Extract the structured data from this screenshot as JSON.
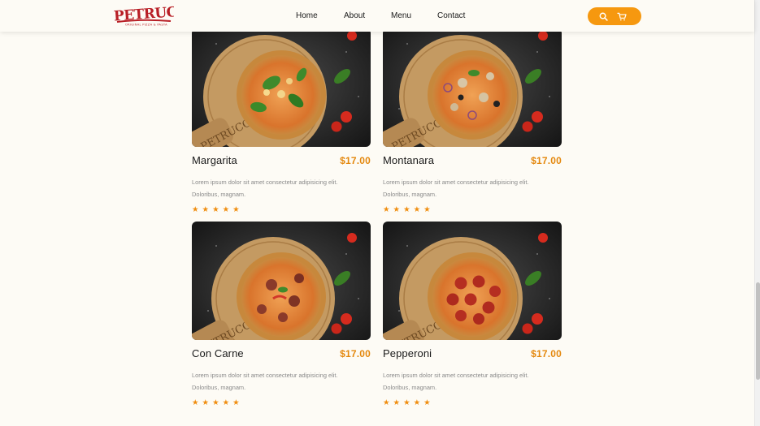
{
  "brand": {
    "logo_text": "PETRUCCIO",
    "logo_tagline": "ORIGINAL PIZZA & PASTA",
    "accent_color": "#f6980f",
    "price_color": "#e4880e",
    "star_color": "#f08d0e"
  },
  "nav": {
    "home": "Home",
    "about": "About",
    "menu": "Menu",
    "contact": "Contact"
  },
  "header_actions": {
    "search_icon": "search-icon",
    "cart_icon": "cart-icon"
  },
  "products": [
    {
      "name": "Margarita",
      "price": "$17.00",
      "desc1": "Lorem ipsum dolor sit amet consectetur adipisicing elit.",
      "desc2": "Doloribus, magnam.",
      "rating": 5,
      "stars": "★ ★ ★ ★ ★"
    },
    {
      "name": "Montanara",
      "price": "$17.00",
      "desc1": "Lorem ipsum dolor sit amet consectetur adipisicing elit.",
      "desc2": "Doloribus, magnam.",
      "rating": 5,
      "stars": "★ ★ ★ ★ ★"
    },
    {
      "name": "Con Carne",
      "price": "$17.00",
      "desc1": "Lorem ipsum dolor sit amet consectetur adipisicing elit.",
      "desc2": "Doloribus, magnam.",
      "rating": 5,
      "stars": "★ ★ ★ ★ ★"
    },
    {
      "name": "Pepperoni",
      "price": "$17.00",
      "desc1": "Lorem ipsum dolor sit amet consectetur adipisicing elit.",
      "desc2": "Doloribus, magnam.",
      "rating": 5,
      "stars": "★ ★ ★ ★ ★"
    }
  ]
}
